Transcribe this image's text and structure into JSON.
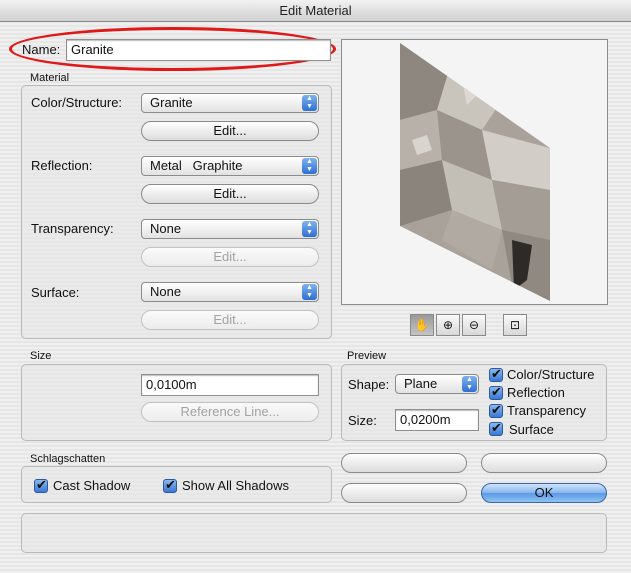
{
  "window": {
    "title": "Edit Material"
  },
  "name_field": {
    "label": "Name:",
    "value": "Granite"
  },
  "material": {
    "group_label": "Material",
    "color_structure": {
      "label": "Color/Structure:",
      "value": "Granite",
      "edit": "Edit..."
    },
    "reflection": {
      "label": "Reflection:",
      "value": "Metal   Graphite",
      "edit": "Edit..."
    },
    "transparency": {
      "label": "Transparency:",
      "value": "None",
      "edit": "Edit..."
    },
    "surface": {
      "label": "Surface:",
      "value": "None",
      "edit": "Edit..."
    }
  },
  "size": {
    "group_label": "Size",
    "value": "0,0100m",
    "reference_line": "Reference Line..."
  },
  "preview": {
    "group_label": "Preview",
    "shape_label": "Shape:",
    "shape_value": "Plane",
    "size_label": "Size:",
    "size_value": "0,0200m",
    "checks": {
      "color_structure": "Color/Structure",
      "reflection": "Reflection",
      "transparency": "Transparency",
      "surface": "Surface"
    }
  },
  "shadows": {
    "group_label": "Schlagschatten",
    "cast_shadow": "Cast Shadow",
    "show_all_shadows": "Show All Shadows"
  },
  "buttons": {
    "ok": "OK"
  },
  "tools": {
    "pan": "hand-icon",
    "zoom_in": "zoom-in-icon",
    "zoom_out": "zoom-out-icon",
    "fit": "zoom-fit-icon"
  },
  "colors": {
    "highlight_oval": "#e01818",
    "accent_blue": "#3a78d4"
  }
}
